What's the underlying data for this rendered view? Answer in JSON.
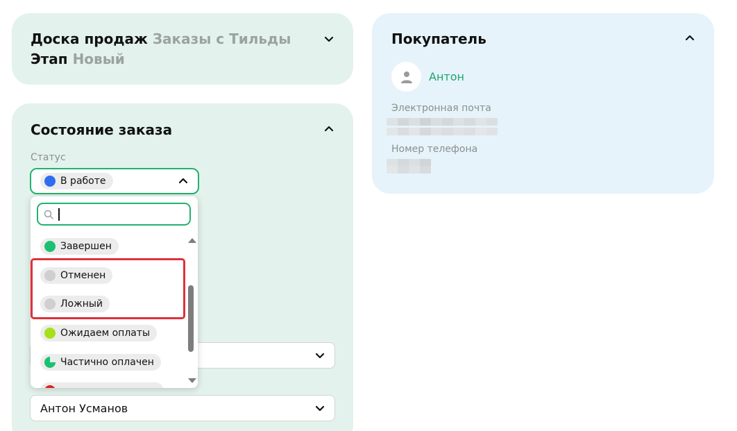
{
  "deal": {
    "board_label": "Доска продаж",
    "board_value": "Заказы с Тильды",
    "stage_label": "Этап",
    "stage_value": "Новый"
  },
  "order_state": {
    "title": "Состояние заказа",
    "status_label": "Статус",
    "status_value": "В работе",
    "status_color": "#2f6df0",
    "search_value": "",
    "options": [
      {
        "label": "Завершен",
        "color": "#1dbf73"
      },
      {
        "label": "Отменен",
        "color": "#cfcfcf"
      },
      {
        "label": "Ложный",
        "color": "#cfcfcf"
      },
      {
        "label": "Ожидаем оплаты",
        "color": "#a6e01a"
      },
      {
        "label": "Частично оплачен",
        "color": "#1dbf73"
      }
    ],
    "responsible_value": "Антон Усманов"
  },
  "buyer": {
    "title": "Покупатель",
    "name": "Антон",
    "email_label": "Электронная почта",
    "phone_label": "Номер телефона"
  },
  "colors": {
    "accent_green": "#22b26e",
    "highlight_red": "#e0303a"
  }
}
